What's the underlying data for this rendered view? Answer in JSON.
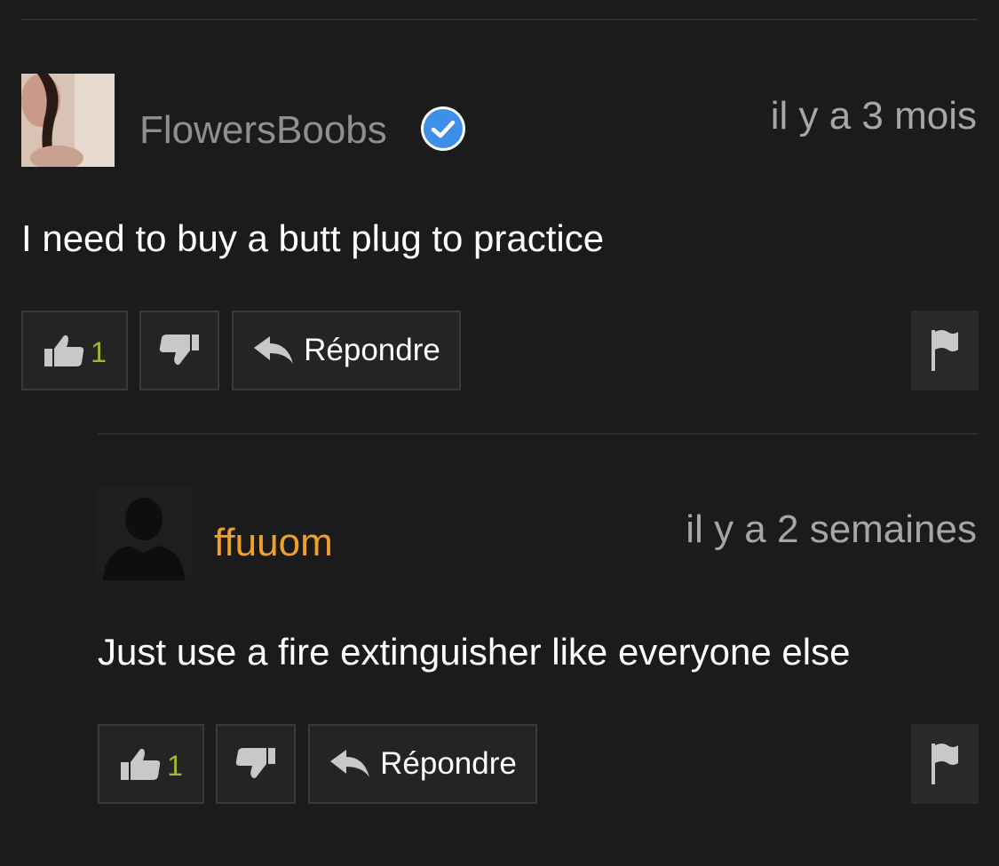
{
  "colors": {
    "background": "#1b1b1b",
    "verified_badge": "#3d8fe8",
    "like_count": "#9bbd2c",
    "second_username": "#f0a028",
    "button_bg": "#242424"
  },
  "comments": [
    {
      "username": "FlowersBoobs",
      "verified": true,
      "timestamp": "il y a 3 mois",
      "text": "I need to buy a butt plug to practice",
      "likes": "1",
      "reply_label": "Répondre",
      "icons": [
        "avatar-photo",
        "verified-check-icon",
        "thumbs-up-icon",
        "thumbs-down-icon",
        "reply-arrow-icon",
        "flag-icon"
      ]
    },
    {
      "username": "ffuuom",
      "verified": false,
      "timestamp": "il y a 2 semaines",
      "text": "Just use a fire extinguisher like everyone else",
      "likes": "1",
      "reply_label": "Répondre",
      "icons": [
        "default-avatar-silhouette-icon",
        "thumbs-up-icon",
        "thumbs-down-icon",
        "reply-arrow-icon",
        "flag-icon"
      ]
    }
  ]
}
